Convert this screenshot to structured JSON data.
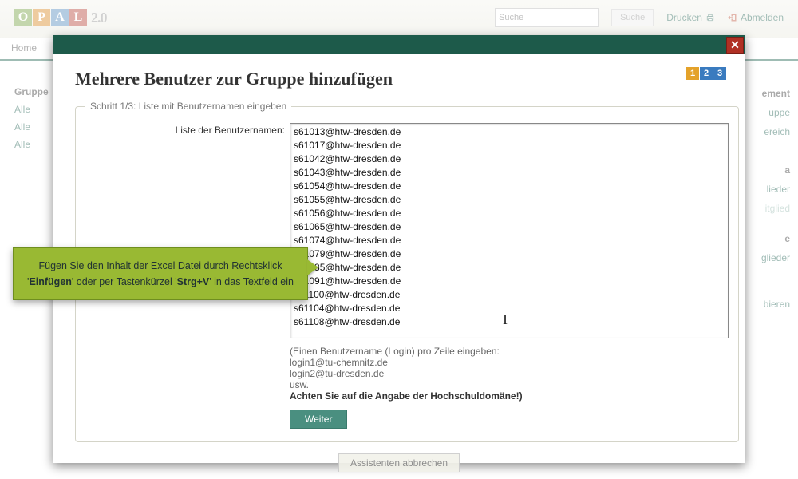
{
  "header": {
    "logo_letters": [
      "O",
      "P",
      "A",
      "L"
    ],
    "logo_tail": "2.0",
    "search_placeholder": "Suche",
    "search_button": "Suche",
    "print_label": "Drucken",
    "logout_label": "Abmelden",
    "tab_home": "Home"
  },
  "left_sidebar": {
    "heading": "Gruppe",
    "items": [
      "Alle",
      "Alle",
      "Alle"
    ]
  },
  "right_sidebar": {
    "items": [
      "ement",
      "uppe",
      "ereich",
      "a",
      "lieder",
      "itglied",
      "e",
      "glieder",
      "bieren"
    ]
  },
  "dialog": {
    "title": "Mehrere Benutzer zur Gruppe hinzufügen",
    "step_legend": "Schritt 1/3: Liste mit Benutzernamen eingeben",
    "field_label": "Liste der Benutzernamen:",
    "userlist_value": "s61013@htw-dresden.de\ns61017@htw-dresden.de\ns61042@htw-dresden.de\ns61043@htw-dresden.de\ns61054@htw-dresden.de\ns61055@htw-dresden.de\ns61056@htw-dresden.de\ns61065@htw-dresden.de\ns61074@htw-dresden.de\ns61079@htw-dresden.de\ns61085@htw-dresden.de\ns61091@htw-dresden.de\ns61100@htw-dresden.de\ns61104@htw-dresden.de\ns61108@htw-dresden.de",
    "hint_line1": "(Einen Benutzername (Login) pro Zeile eingeben:",
    "hint_ex1": "login1@tu-chemnitz.de",
    "hint_ex2": "login2@tu-dresden.de",
    "hint_etc": "usw.",
    "hint_strong": "Achten Sie auf die Angabe der Hochschuldomäne!)",
    "continue_button": "Weiter",
    "cancel_button": "Assistenten abbrechen",
    "steps": [
      "1",
      "2",
      "3"
    ]
  },
  "callout": {
    "prefix": "Fügen Sie den Inhalt der Excel Datei durch Rechtsklick '",
    "bold1": "Einfügen",
    "mid": "' oder per Tastenkürzel '",
    "bold2": "Strg+V",
    "suffix": "' in das Textfeld ein"
  }
}
